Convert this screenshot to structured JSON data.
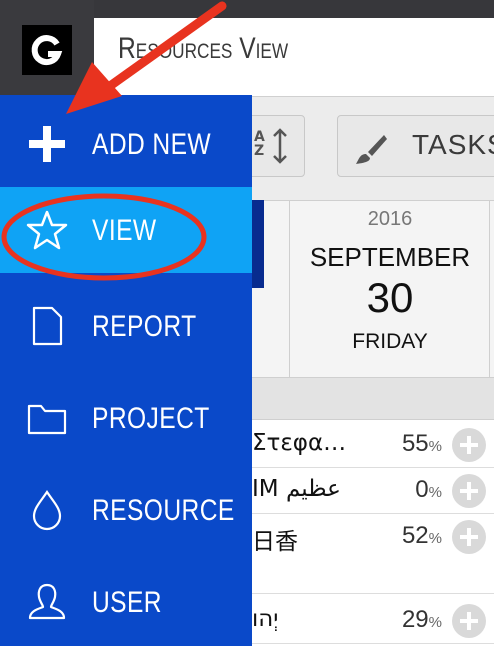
{
  "header": {
    "logo_letter": "G",
    "view_title": "Resources View"
  },
  "toolbar": {
    "sort_label": "A Z",
    "tasks_label": "TASKS"
  },
  "calendar": {
    "year": "2016",
    "month": "SEPTEMBER",
    "day": "30",
    "weekday": "FRIDAY"
  },
  "resources": [
    {
      "name": "Στεφα…",
      "percent": "55",
      "unit": "%"
    },
    {
      "name": "IM عظيم",
      "percent": "0",
      "unit": "%"
    },
    {
      "name": "日香",
      "percent": "52",
      "unit": "%"
    },
    {
      "name": "יְהו",
      "percent": "29",
      "unit": "%"
    }
  ],
  "sidemenu": {
    "items": [
      {
        "label": "ADD NEW",
        "icon": "plus-icon"
      },
      {
        "label": "VIEW",
        "icon": "star-icon",
        "active": true
      },
      {
        "label": "REPORT",
        "icon": "document-icon"
      },
      {
        "label": "PROJECT",
        "icon": "folder-icon"
      },
      {
        "label": "RESOURCE",
        "icon": "drop-icon"
      },
      {
        "label": "USER",
        "icon": "user-icon"
      }
    ]
  },
  "colors": {
    "menu_bg": "#0a49c9",
    "menu_active": "#0fa3f5",
    "annotation_red": "#e8331f",
    "topbar": "#37373b"
  }
}
